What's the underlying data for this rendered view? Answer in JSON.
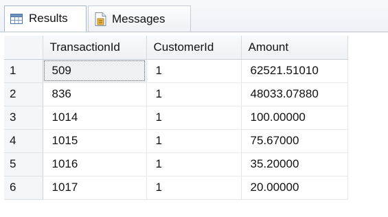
{
  "tabs": {
    "results": {
      "label": "Results",
      "icon": "results-grid-icon"
    },
    "messages": {
      "label": "Messages",
      "icon": "messages-document-icon"
    }
  },
  "grid": {
    "columns": [
      "TransactionId",
      "CustomerId",
      "Amount"
    ],
    "rows": [
      {
        "num": "1",
        "cells": [
          "509",
          "1",
          "62521.51010"
        ]
      },
      {
        "num": "2",
        "cells": [
          "836",
          "1",
          "48033.07880"
        ]
      },
      {
        "num": "3",
        "cells": [
          "1014",
          "1",
          "100.00000"
        ]
      },
      {
        "num": "4",
        "cells": [
          "1015",
          "1",
          "75.67000"
        ]
      },
      {
        "num": "5",
        "cells": [
          "1016",
          "1",
          "35.20000"
        ]
      },
      {
        "num": "6",
        "cells": [
          "1017",
          "1",
          "20.00000"
        ]
      }
    ]
  }
}
